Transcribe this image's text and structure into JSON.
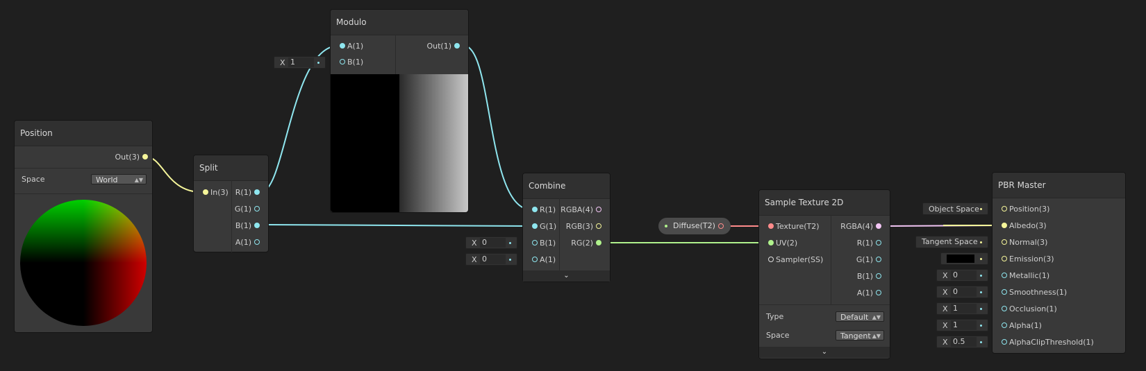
{
  "nodes": {
    "position": {
      "title": "Position",
      "out": "Out(3)",
      "space_label": "Space",
      "space_value": "World"
    },
    "split": {
      "title": "Split",
      "in": "In(3)",
      "outs": [
        "R(1)",
        "G(1)",
        "B(1)",
        "A(1)"
      ]
    },
    "modulo": {
      "title": "Modulo",
      "ins": [
        "A(1)",
        "B(1)"
      ],
      "out": "Out(1)",
      "b_value": "1"
    },
    "combine": {
      "title": "Combine",
      "ins": [
        "R(1)",
        "G(1)",
        "B(1)",
        "A(1)"
      ],
      "outs": [
        "RGBA(4)",
        "RGB(3)",
        "RG(2)"
      ],
      "b_value": "0",
      "a_value": "0"
    },
    "diffuse": {
      "label": "Diffuse(T2)"
    },
    "sample": {
      "title": "Sample Texture 2D",
      "ins": [
        "Texture(T2)",
        "UV(2)",
        "Sampler(SS)"
      ],
      "outs": [
        "RGBA(4)",
        "R(1)",
        "G(1)",
        "B(1)",
        "A(1)"
      ],
      "type_label": "Type",
      "type_value": "Default",
      "space_label": "Space",
      "space_value": "Tangent"
    },
    "pbr": {
      "title": "PBR Master",
      "ins": [
        "Position(3)",
        "Albedo(3)",
        "Normal(3)",
        "Emission(3)",
        "Metallic(1)",
        "Smoothness(1)",
        "Occlusion(1)",
        "Alpha(1)",
        "AlphaClipThreshold(1)"
      ],
      "position_space": "Object Space",
      "normal_space": "Tangent Space",
      "metallic": "0",
      "smoothness": "0",
      "occlusion": "1",
      "alpha": "1",
      "alpha_clip": "0.5"
    }
  },
  "value_prefix": "X",
  "colors": {
    "background": "#1f1f1f",
    "node": "#393939",
    "vector1": "#8fe6ef",
    "vector2": "#b0f28c",
    "vector3": "#f5f59a",
    "vector4": "#f3c6f5",
    "texture": "#ff8b8b"
  }
}
